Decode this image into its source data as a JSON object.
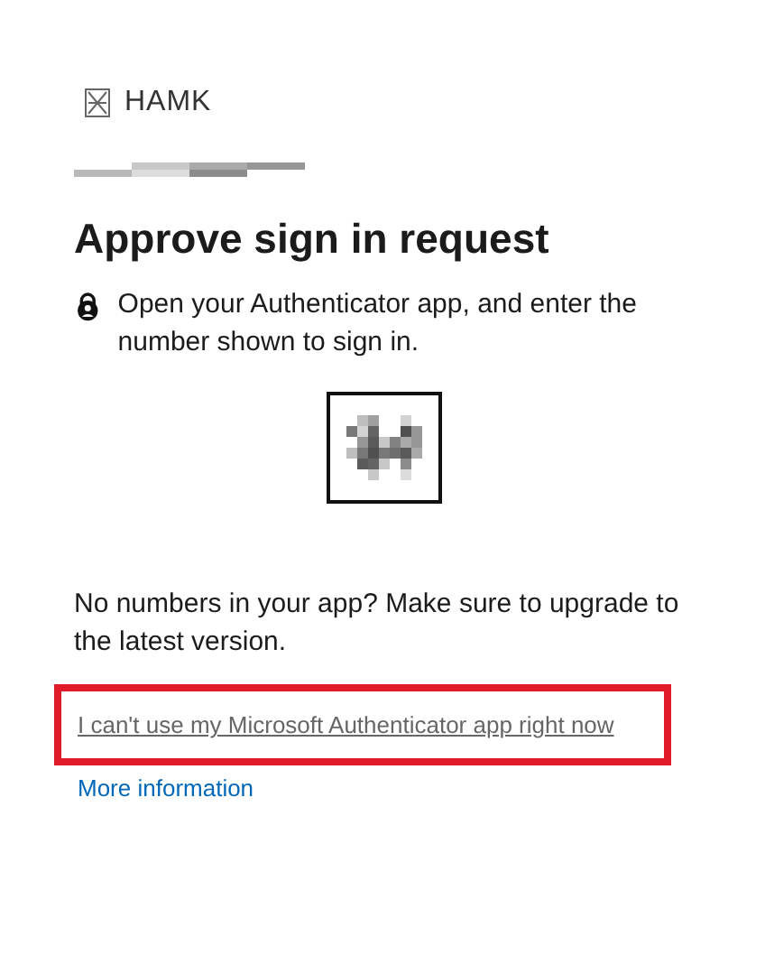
{
  "logo": {
    "text": "HAMK"
  },
  "title": "Approve sign in request",
  "instruction": "Open your Authenticator app, and enter the number shown to sign in.",
  "hint": "No numbers in your app? Make sure to upgrade to the latest version.",
  "links": [
    {
      "text": "I can't use my Microsoft Authenticator app right now",
      "kind": "fallback",
      "highlighted": true
    },
    {
      "text": "More information",
      "kind": "info",
      "highlighted": false
    }
  ]
}
